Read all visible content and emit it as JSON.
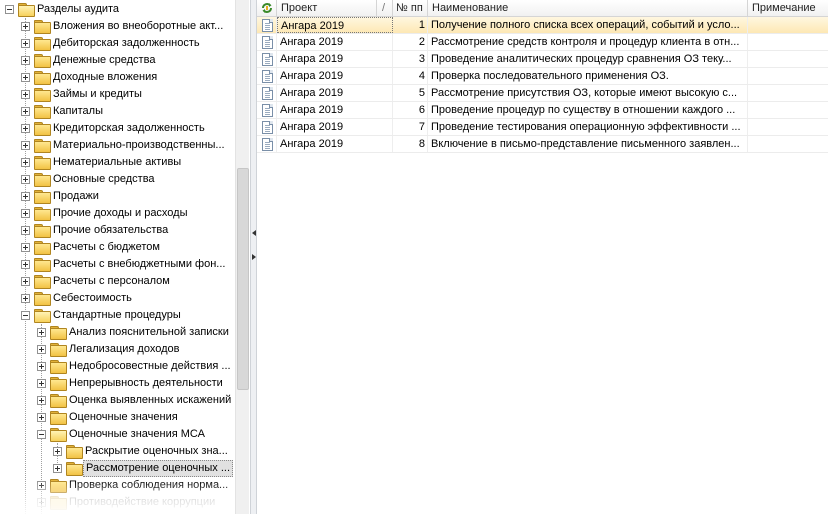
{
  "tree": {
    "items": [
      {
        "label": "Разделы аудита",
        "level": 0,
        "toggle": "minus",
        "open": true
      },
      {
        "label": "Вложения во внеоборотные акт...",
        "level": 1,
        "toggle": "plus"
      },
      {
        "label": "Дебиторская задолженность",
        "level": 1,
        "toggle": "plus"
      },
      {
        "label": "Денежные средства",
        "level": 1,
        "toggle": "plus"
      },
      {
        "label": "Доходные вложения",
        "level": 1,
        "toggle": "plus"
      },
      {
        "label": "Займы и кредиты",
        "level": 1,
        "toggle": "plus"
      },
      {
        "label": "Капиталы",
        "level": 1,
        "toggle": "plus"
      },
      {
        "label": "Кредиторская задолженность",
        "level": 1,
        "toggle": "plus"
      },
      {
        "label": "Материально-производственны...",
        "level": 1,
        "toggle": "plus"
      },
      {
        "label": "Нематериальные активы",
        "level": 1,
        "toggle": "plus"
      },
      {
        "label": "Основные средства",
        "level": 1,
        "toggle": "plus"
      },
      {
        "label": "Продажи",
        "level": 1,
        "toggle": "plus"
      },
      {
        "label": "Прочие доходы и расходы",
        "level": 1,
        "toggle": "plus"
      },
      {
        "label": "Прочие обязательства",
        "level": 1,
        "toggle": "plus"
      },
      {
        "label": "Расчеты с бюджетом",
        "level": 1,
        "toggle": "plus"
      },
      {
        "label": "Расчеты с внебюджетными фон...",
        "level": 1,
        "toggle": "plus"
      },
      {
        "label": "Расчеты с персоналом",
        "level": 1,
        "toggle": "plus"
      },
      {
        "label": "Себестоимость",
        "level": 1,
        "toggle": "plus"
      },
      {
        "label": "Стандартные процедуры",
        "level": 1,
        "toggle": "minus",
        "open": true
      },
      {
        "label": "Анализ пояснительной записки",
        "level": 2,
        "toggle": "plus"
      },
      {
        "label": "Легализация доходов",
        "level": 2,
        "toggle": "plus"
      },
      {
        "label": "Недобросовестные действия ...",
        "level": 2,
        "toggle": "plus"
      },
      {
        "label": "Непрерывность деятельности",
        "level": 2,
        "toggle": "plus"
      },
      {
        "label": "Оценка выявленных искажений",
        "level": 2,
        "toggle": "plus"
      },
      {
        "label": "Оценочные значения",
        "level": 2,
        "toggle": "plus"
      },
      {
        "label": "Оценочные значения МСА",
        "level": 2,
        "toggle": "minus",
        "open": true
      },
      {
        "label": "Раскрытие оценочных зна...",
        "level": 3,
        "toggle": "plus"
      },
      {
        "label": "Рассмотрение оценочных ...",
        "level": 3,
        "toggle": "plus",
        "selected": true
      },
      {
        "label": "Проверка соблюдения норма...",
        "level": 2,
        "toggle": "plus"
      },
      {
        "label": "Противодействие коррупции",
        "level": 2,
        "toggle": "plus",
        "faded": true
      }
    ]
  },
  "grid": {
    "columns": [
      {
        "label": ""
      },
      {
        "label": "Проект"
      },
      {
        "label": "/"
      },
      {
        "label": "№ пп"
      },
      {
        "label": "Наименование"
      },
      {
        "label": "Примечание"
      }
    ],
    "rows": [
      {
        "project": "Ангара 2019",
        "num": "1",
        "name": "Получение полного списка всех операций, событий и усло..."
      },
      {
        "project": "Ангара 2019",
        "num": "2",
        "name": "Рассмотрение средств контроля и процедур клиента в отн..."
      },
      {
        "project": "Ангара 2019",
        "num": "3",
        "name": "Проведение аналитических процедур сравнения ОЗ теку..."
      },
      {
        "project": "Ангара 2019",
        "num": "4",
        "name": "Проверка последовательного применения ОЗ."
      },
      {
        "project": "Ангара 2019",
        "num": "5",
        "name": "Рассмотрение присутствия ОЗ, которые имеют высокую с..."
      },
      {
        "project": "Ангара 2019",
        "num": "6",
        "name": "Проведение процедур по существу в отношении каждого ..."
      },
      {
        "project": "Ангара 2019",
        "num": "7",
        "name": "Проведение тестирования операционную эффективности ..."
      },
      {
        "project": "Ангара 2019",
        "num": "8",
        "name": "Включение в письмо-представление письменного заявлен..."
      }
    ]
  },
  "icons": {
    "tree_node": "folder-icon",
    "grid_row": "document-icon",
    "grid_header": "refresh-icon"
  },
  "colors": {
    "current_row_top": "#fff7e0",
    "current_row_bottom": "#fde8b4",
    "folder": "#f2c244",
    "selection": "#e1e1e1"
  }
}
